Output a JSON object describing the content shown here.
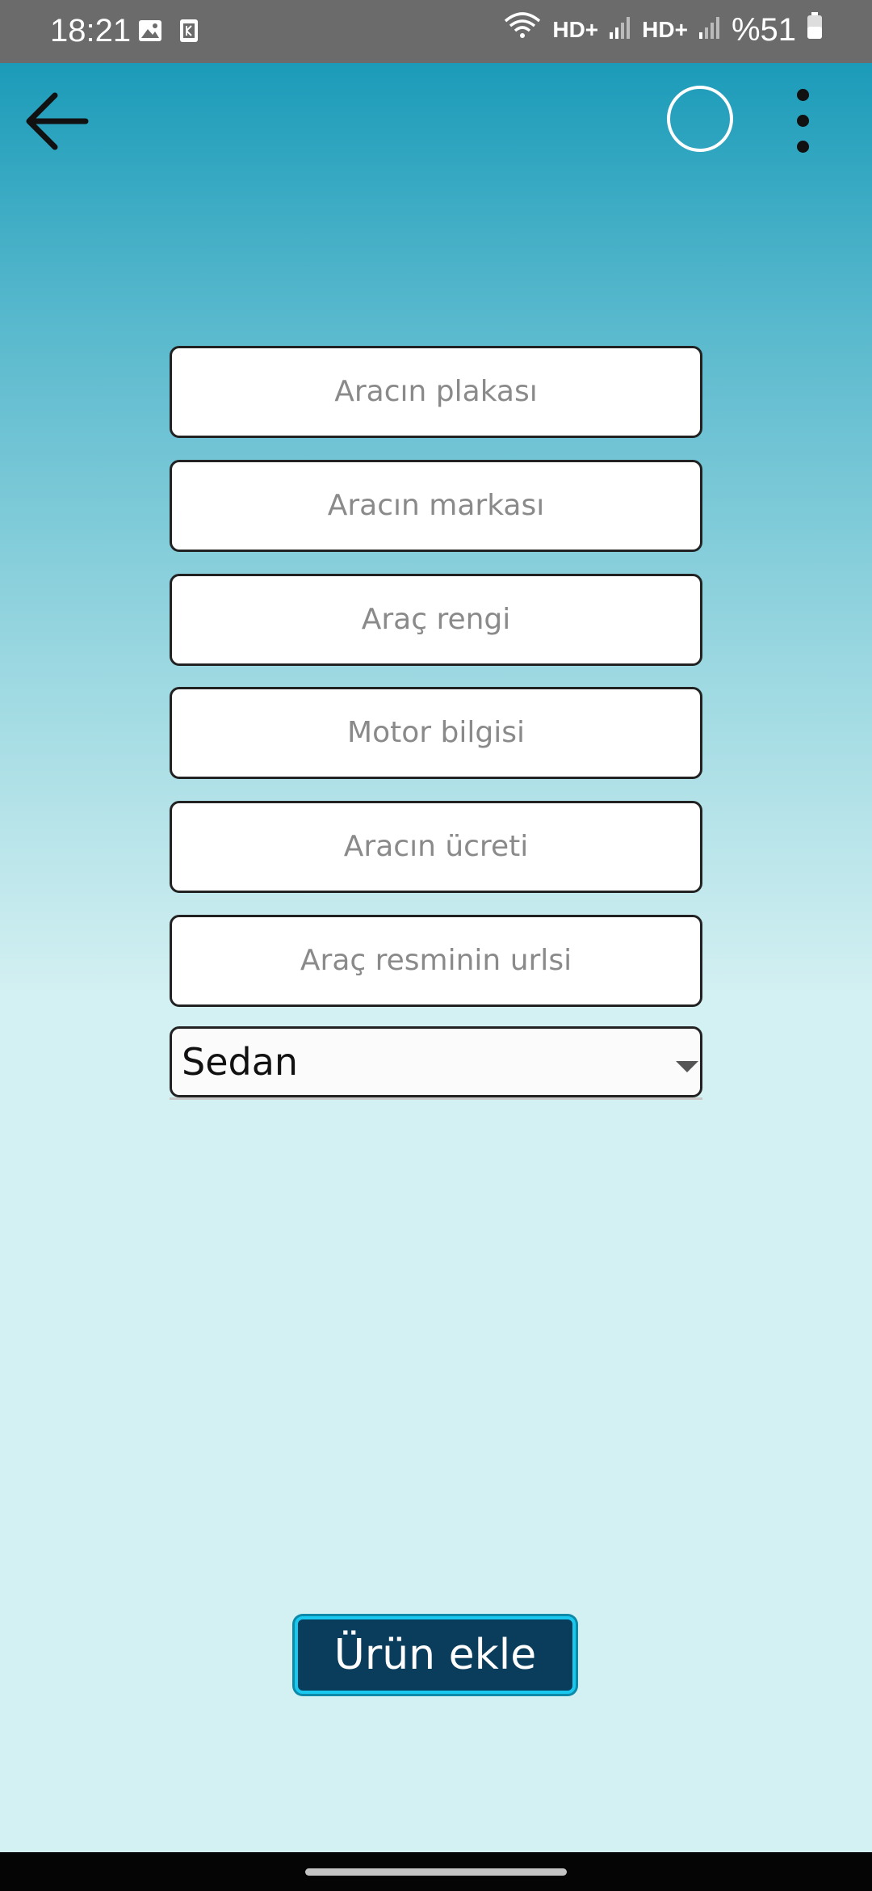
{
  "status_bar": {
    "time": "18:21",
    "battery": "%51",
    "sim1_label": "HD+",
    "sim2_label": "HD+",
    "icons": [
      "gallery-icon",
      "notification-k-icon",
      "wifi-icon",
      "signal-icon",
      "battery-icon"
    ]
  },
  "toolbar": {
    "back_icon": "arrow-left-icon",
    "action_icon": "circle-icon",
    "menu_icon": "more-vert-icon"
  },
  "form": {
    "fields": [
      {
        "placeholder": "Aracın plakası",
        "value": ""
      },
      {
        "placeholder": "Aracın markası",
        "value": ""
      },
      {
        "placeholder": "Araç rengi",
        "value": ""
      },
      {
        "placeholder": "Motor bilgisi",
        "value": ""
      },
      {
        "placeholder": "Aracın ücreti",
        "value": ""
      },
      {
        "placeholder": "Araç resminin urlsi",
        "value": ""
      }
    ],
    "category_select": {
      "selected": "Sedan"
    },
    "submit_label": "Ürün ekle"
  },
  "colors": {
    "gradient_top": "#1b9bb9",
    "background": "#d3f0f2",
    "button_bg": "#0a3d5c",
    "button_border": "#19c8ee"
  }
}
